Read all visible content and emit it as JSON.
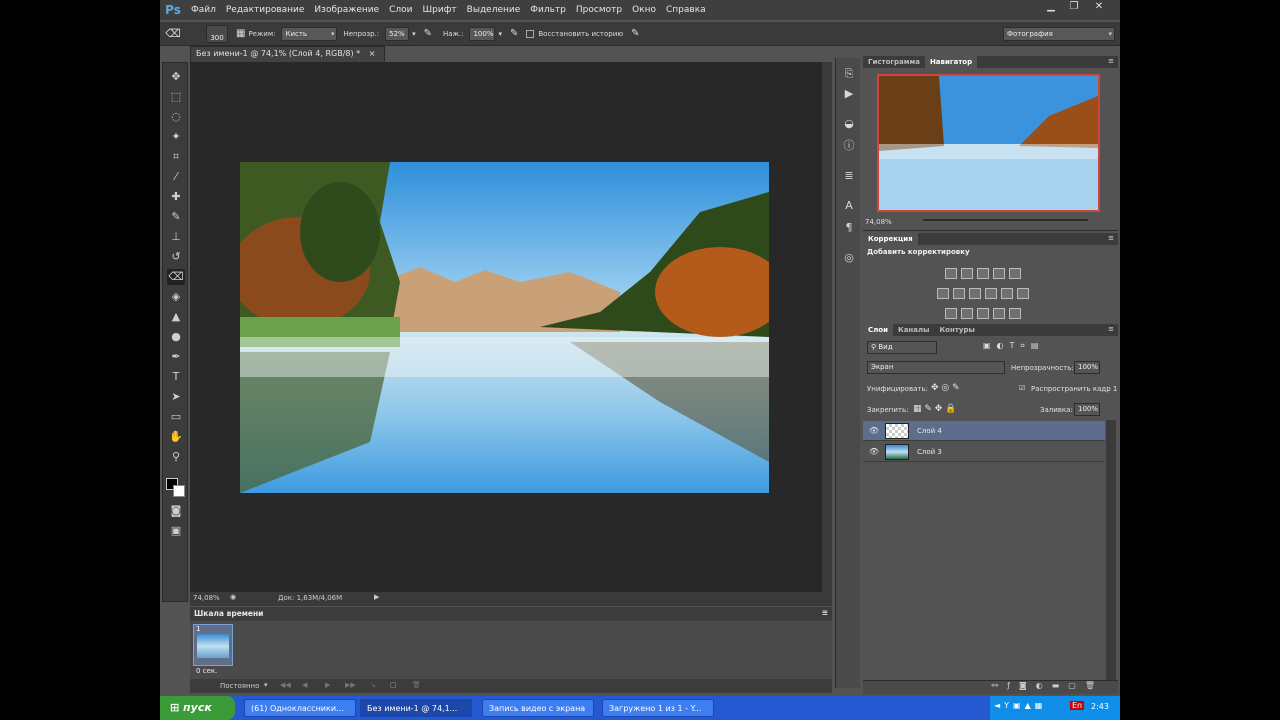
{
  "app": {
    "logo": "Ps"
  },
  "menu": [
    "Файл",
    "Редактирование",
    "Изображение",
    "Слои",
    "Шрифт",
    "Выделение",
    "Фильтр",
    "Просмотр",
    "Окно",
    "Справка"
  ],
  "options": {
    "brush_size": "300",
    "mode_label": "Режим:",
    "mode_value": "Кисть",
    "opacity_label": "Непрозр.:",
    "opacity_value": "52%",
    "flow_label": "Наж.:",
    "flow_value": "100%",
    "history_label": "Восстановить историю",
    "workspace": "Фотография"
  },
  "document": {
    "tab_title": "Без имени-1 @ 74,1% (Слой 4, RGB/8) *",
    "zoom": "74,08%",
    "doc_size": "Док: 1,63M/4,06M"
  },
  "timeline": {
    "title": "Шкала времени",
    "frame_number": "1",
    "frame_delay": "0 сек.",
    "loop": "Постоянно"
  },
  "navigator": {
    "tabs": [
      "Гистограмма",
      "Навигатор"
    ],
    "zoom": "74,08%"
  },
  "adjustments": {
    "tab": "Коррекция",
    "subtitle": "Добавить корректировку"
  },
  "layers": {
    "tabs": [
      "Слои",
      "Каналы",
      "Контуры"
    ],
    "filter": "Вид",
    "blend_mode": "Экран",
    "opacity_label": "Непрозрачность:",
    "opacity_value": "100%",
    "unify_label": "Унифицировать:",
    "propagate_label": "Распространить кадр 1",
    "lock_label": "Закрепить:",
    "fill_label": "Заливка:",
    "fill_value": "100%",
    "items": [
      {
        "name": "Слой 4",
        "selected": true
      },
      {
        "name": "Слой 3",
        "selected": false
      }
    ]
  },
  "taskbar": {
    "start": "пуск",
    "tasks": [
      {
        "label": "(61) Одноклассники..."
      },
      {
        "label": "Без имени-1 @ 74,1..."
      },
      {
        "label": "Запись видео с экрана"
      },
      {
        "label": "Загружено 1 из 1 - Y..."
      }
    ],
    "lang": "En",
    "clock": "2:43"
  },
  "colors": {
    "accent_layer": "#5d6e8c",
    "taskbar": "#2459d1",
    "start": "#3c9b39"
  }
}
